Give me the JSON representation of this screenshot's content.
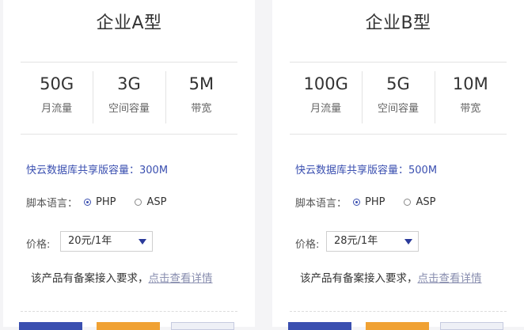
{
  "plans": [
    {
      "title": "企业A型",
      "specs": [
        {
          "value": "50G",
          "label": "月流量"
        },
        {
          "value": "3G",
          "label": "空间容量"
        },
        {
          "value": "5M",
          "label": "带宽"
        }
      ],
      "db_capacity": "快云数据库共享版容量：300M",
      "lang_label": "脚本语言：",
      "lang_options": [
        "PHP",
        "ASP"
      ],
      "lang_selected": "PHP",
      "price_label": "价格:",
      "price_value": "20元/1年",
      "note_text": "该产品有备案接入要求，",
      "note_link": "点击查看详情"
    },
    {
      "title": "企业B型",
      "specs": [
        {
          "value": "100G",
          "label": "月流量"
        },
        {
          "value": "5G",
          "label": "空间容量"
        },
        {
          "value": "10M",
          "label": "带宽"
        }
      ],
      "db_capacity": "快云数据库共享版容量：500M",
      "lang_label": "脚本语言：",
      "lang_options": [
        "PHP",
        "ASP"
      ],
      "lang_selected": "PHP",
      "price_label": "价格:",
      "price_value": "28元/1年",
      "note_text": "该产品有备案接入要求，",
      "note_link": "点击查看详情"
    }
  ],
  "colors": {
    "accent": "#3a4fb0",
    "orange": "#f0a133",
    "link": "#8a8fb0"
  }
}
